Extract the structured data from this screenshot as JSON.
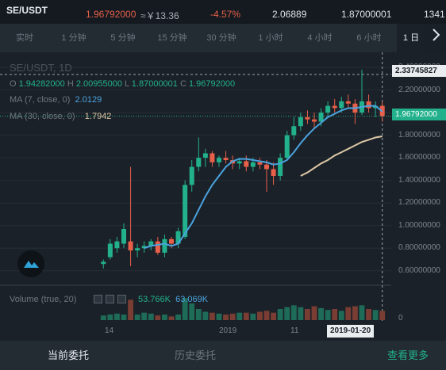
{
  "ticker": {
    "pair": "SE/USDT",
    "last_price": "1.96792000",
    "cny_price": "≈￥13.36",
    "change": "-4.57%",
    "high": "2.06889",
    "low": "1.87000001",
    "volume": "1341"
  },
  "tabs": [
    {
      "label": "实时",
      "active": false
    },
    {
      "label": "1 分钟",
      "active": false
    },
    {
      "label": "5 分钟",
      "active": false
    },
    {
      "label": "15 分钟",
      "active": false
    },
    {
      "label": "30 分钟",
      "active": false
    },
    {
      "label": "1 小时",
      "active": false
    },
    {
      "label": "4 小时",
      "active": false
    },
    {
      "label": "6 小时",
      "active": false
    },
    {
      "label": "1 日",
      "active": true
    }
  ],
  "tabs_more_icon": "chevron-right-icon",
  "legend": {
    "title": "SE/USDT, 1D",
    "o_label": "O",
    "o": "1.94282000",
    "h_label": "H",
    "h": "2.00955000",
    "l_label": "L",
    "l": "1.87000001",
    "c_label": "C",
    "c": "1.96792000",
    "ma7_label": "MA (7, close, 0)",
    "ma7": "2.0129",
    "ma30_label": "MA (30, close, 0)",
    "ma30": "1.7942",
    "vol_label": "Volume (true, 20)",
    "vol1": "53.766K",
    "vol2": "63.069K"
  },
  "price_axis": {
    "ticks": [
      "2.40000000",
      "2.20000000",
      "2.00000000",
      "1.80000000",
      "1.60000000",
      "1.40000000",
      "1.20000000",
      "1.00000000",
      "0.80000000",
      "0.60000000"
    ],
    "crosshair_price": "2.33745827",
    "last_price_tag": "1.96792000",
    "volume_zero": "0"
  },
  "time_axis": {
    "labels": [
      "14",
      "2019",
      "11"
    ],
    "crosshair_date": "2019-01-20"
  },
  "bottom_tabs": {
    "current_orders": "当前委托",
    "history_orders": "历史委托",
    "view_more": "查看更多"
  },
  "colors": {
    "up": "#22b18c",
    "down": "#e85f4a",
    "ma7": "#4aa3df",
    "ma30": "#dcc7a6",
    "background": "#1b2128"
  },
  "chart_data": {
    "type": "candlestick",
    "interval": "1D",
    "ylim": [
      0.5,
      2.45
    ],
    "candles": [
      {
        "o": 0.66,
        "h": 0.7,
        "l": 0.62,
        "c": 0.68
      },
      {
        "o": 0.72,
        "h": 0.88,
        "l": 0.7,
        "c": 0.84
      },
      {
        "o": 0.8,
        "h": 0.9,
        "l": 0.76,
        "c": 0.86
      },
      {
        "o": 0.84,
        "h": 1.02,
        "l": 0.8,
        "c": 0.97
      },
      {
        "o": 0.86,
        "h": 1.52,
        "l": 0.64,
        "c": 0.78
      },
      {
        "o": 0.78,
        "h": 0.84,
        "l": 0.72,
        "c": 0.8
      },
      {
        "o": 0.8,
        "h": 0.86,
        "l": 0.76,
        "c": 0.82
      },
      {
        "o": 0.82,
        "h": 0.88,
        "l": 0.78,
        "c": 0.86
      },
      {
        "o": 0.86,
        "h": 0.9,
        "l": 0.74,
        "c": 0.76
      },
      {
        "o": 0.76,
        "h": 0.92,
        "l": 0.72,
        "c": 0.88
      },
      {
        "o": 0.88,
        "h": 0.9,
        "l": 0.8,
        "c": 0.84
      },
      {
        "o": 0.84,
        "h": 0.98,
        "l": 0.8,
        "c": 0.95
      },
      {
        "o": 0.9,
        "h": 1.4,
        "l": 0.88,
        "c": 1.36
      },
      {
        "o": 1.36,
        "h": 1.58,
        "l": 1.3,
        "c": 1.52
      },
      {
        "o": 1.52,
        "h": 1.78,
        "l": 1.48,
        "c": 1.6
      },
      {
        "o": 1.6,
        "h": 1.68,
        "l": 1.52,
        "c": 1.64
      },
      {
        "o": 1.64,
        "h": 1.66,
        "l": 1.52,
        "c": 1.56
      },
      {
        "o": 1.56,
        "h": 1.62,
        "l": 1.52,
        "c": 1.6
      },
      {
        "o": 1.6,
        "h": 1.66,
        "l": 1.55,
        "c": 1.58
      },
      {
        "o": 1.58,
        "h": 1.62,
        "l": 1.5,
        "c": 1.55
      },
      {
        "o": 1.55,
        "h": 1.6,
        "l": 1.5,
        "c": 1.57
      },
      {
        "o": 1.57,
        "h": 1.62,
        "l": 1.48,
        "c": 1.52
      },
      {
        "o": 1.52,
        "h": 1.6,
        "l": 1.48,
        "c": 1.56
      },
      {
        "o": 1.56,
        "h": 1.6,
        "l": 1.5,
        "c": 1.54
      },
      {
        "o": 1.54,
        "h": 1.58,
        "l": 1.3,
        "c": 1.5
      },
      {
        "o": 1.5,
        "h": 1.56,
        "l": 1.36,
        "c": 1.44
      },
      {
        "o": 1.44,
        "h": 1.64,
        "l": 1.4,
        "c": 1.6
      },
      {
        "o": 1.6,
        "h": 1.84,
        "l": 1.58,
        "c": 1.8
      },
      {
        "o": 1.8,
        "h": 1.96,
        "l": 1.76,
        "c": 1.88
      },
      {
        "o": 1.88,
        "h": 2.0,
        "l": 1.84,
        "c": 1.96
      },
      {
        "o": 1.96,
        "h": 2.02,
        "l": 1.9,
        "c": 1.94
      },
      {
        "o": 1.94,
        "h": 2.0,
        "l": 1.86,
        "c": 1.92
      },
      {
        "o": 1.92,
        "h": 2.04,
        "l": 1.88,
        "c": 2.0
      },
      {
        "o": 2.0,
        "h": 2.1,
        "l": 1.96,
        "c": 2.06
      },
      {
        "o": 2.06,
        "h": 2.12,
        "l": 2.0,
        "c": 2.04
      },
      {
        "o": 2.04,
        "h": 2.14,
        "l": 2.0,
        "c": 2.1
      },
      {
        "o": 2.1,
        "h": 2.16,
        "l": 2.04,
        "c": 2.08
      },
      {
        "o": 2.08,
        "h": 2.12,
        "l": 1.9,
        "c": 2.0
      },
      {
        "o": 2.0,
        "h": 2.38,
        "l": 1.98,
        "c": 2.1
      },
      {
        "o": 2.1,
        "h": 2.16,
        "l": 2.0,
        "c": 2.04
      },
      {
        "o": 2.04,
        "h": 2.1,
        "l": 1.96,
        "c": 2.06
      },
      {
        "o": 2.06,
        "h": 2.1,
        "l": 1.92,
        "c": 1.97
      }
    ],
    "ma7": [
      null,
      null,
      null,
      null,
      null,
      null,
      0.8,
      0.82,
      0.83,
      0.84,
      0.82,
      0.84,
      0.93,
      1.02,
      1.14,
      1.26,
      1.36,
      1.44,
      1.52,
      1.57,
      1.59,
      1.59,
      1.58,
      1.57,
      1.56,
      1.54,
      1.55,
      1.58,
      1.65,
      1.73,
      1.8,
      1.86,
      1.91,
      1.96,
      1.99,
      2.02,
      2.04,
      2.04,
      2.05,
      2.06,
      2.06,
      2.01
    ],
    "ma30": [
      null,
      null,
      null,
      null,
      null,
      null,
      null,
      null,
      null,
      null,
      null,
      null,
      null,
      null,
      null,
      null,
      null,
      null,
      null,
      null,
      null,
      null,
      null,
      null,
      null,
      null,
      null,
      null,
      null,
      1.44,
      1.47,
      1.51,
      1.55,
      1.58,
      1.62,
      1.65,
      1.68,
      1.71,
      1.74,
      1.76,
      1.78,
      1.79
    ],
    "volume": [
      5,
      6,
      7,
      6,
      22,
      6,
      8,
      7,
      5,
      6,
      4,
      6,
      24,
      18,
      12,
      9,
      8,
      7,
      6,
      7,
      8,
      8,
      7,
      9,
      10,
      8,
      12,
      14,
      16,
      14,
      12,
      15,
      13,
      11,
      12,
      10,
      14,
      15,
      16,
      12,
      11,
      10
    ]
  }
}
